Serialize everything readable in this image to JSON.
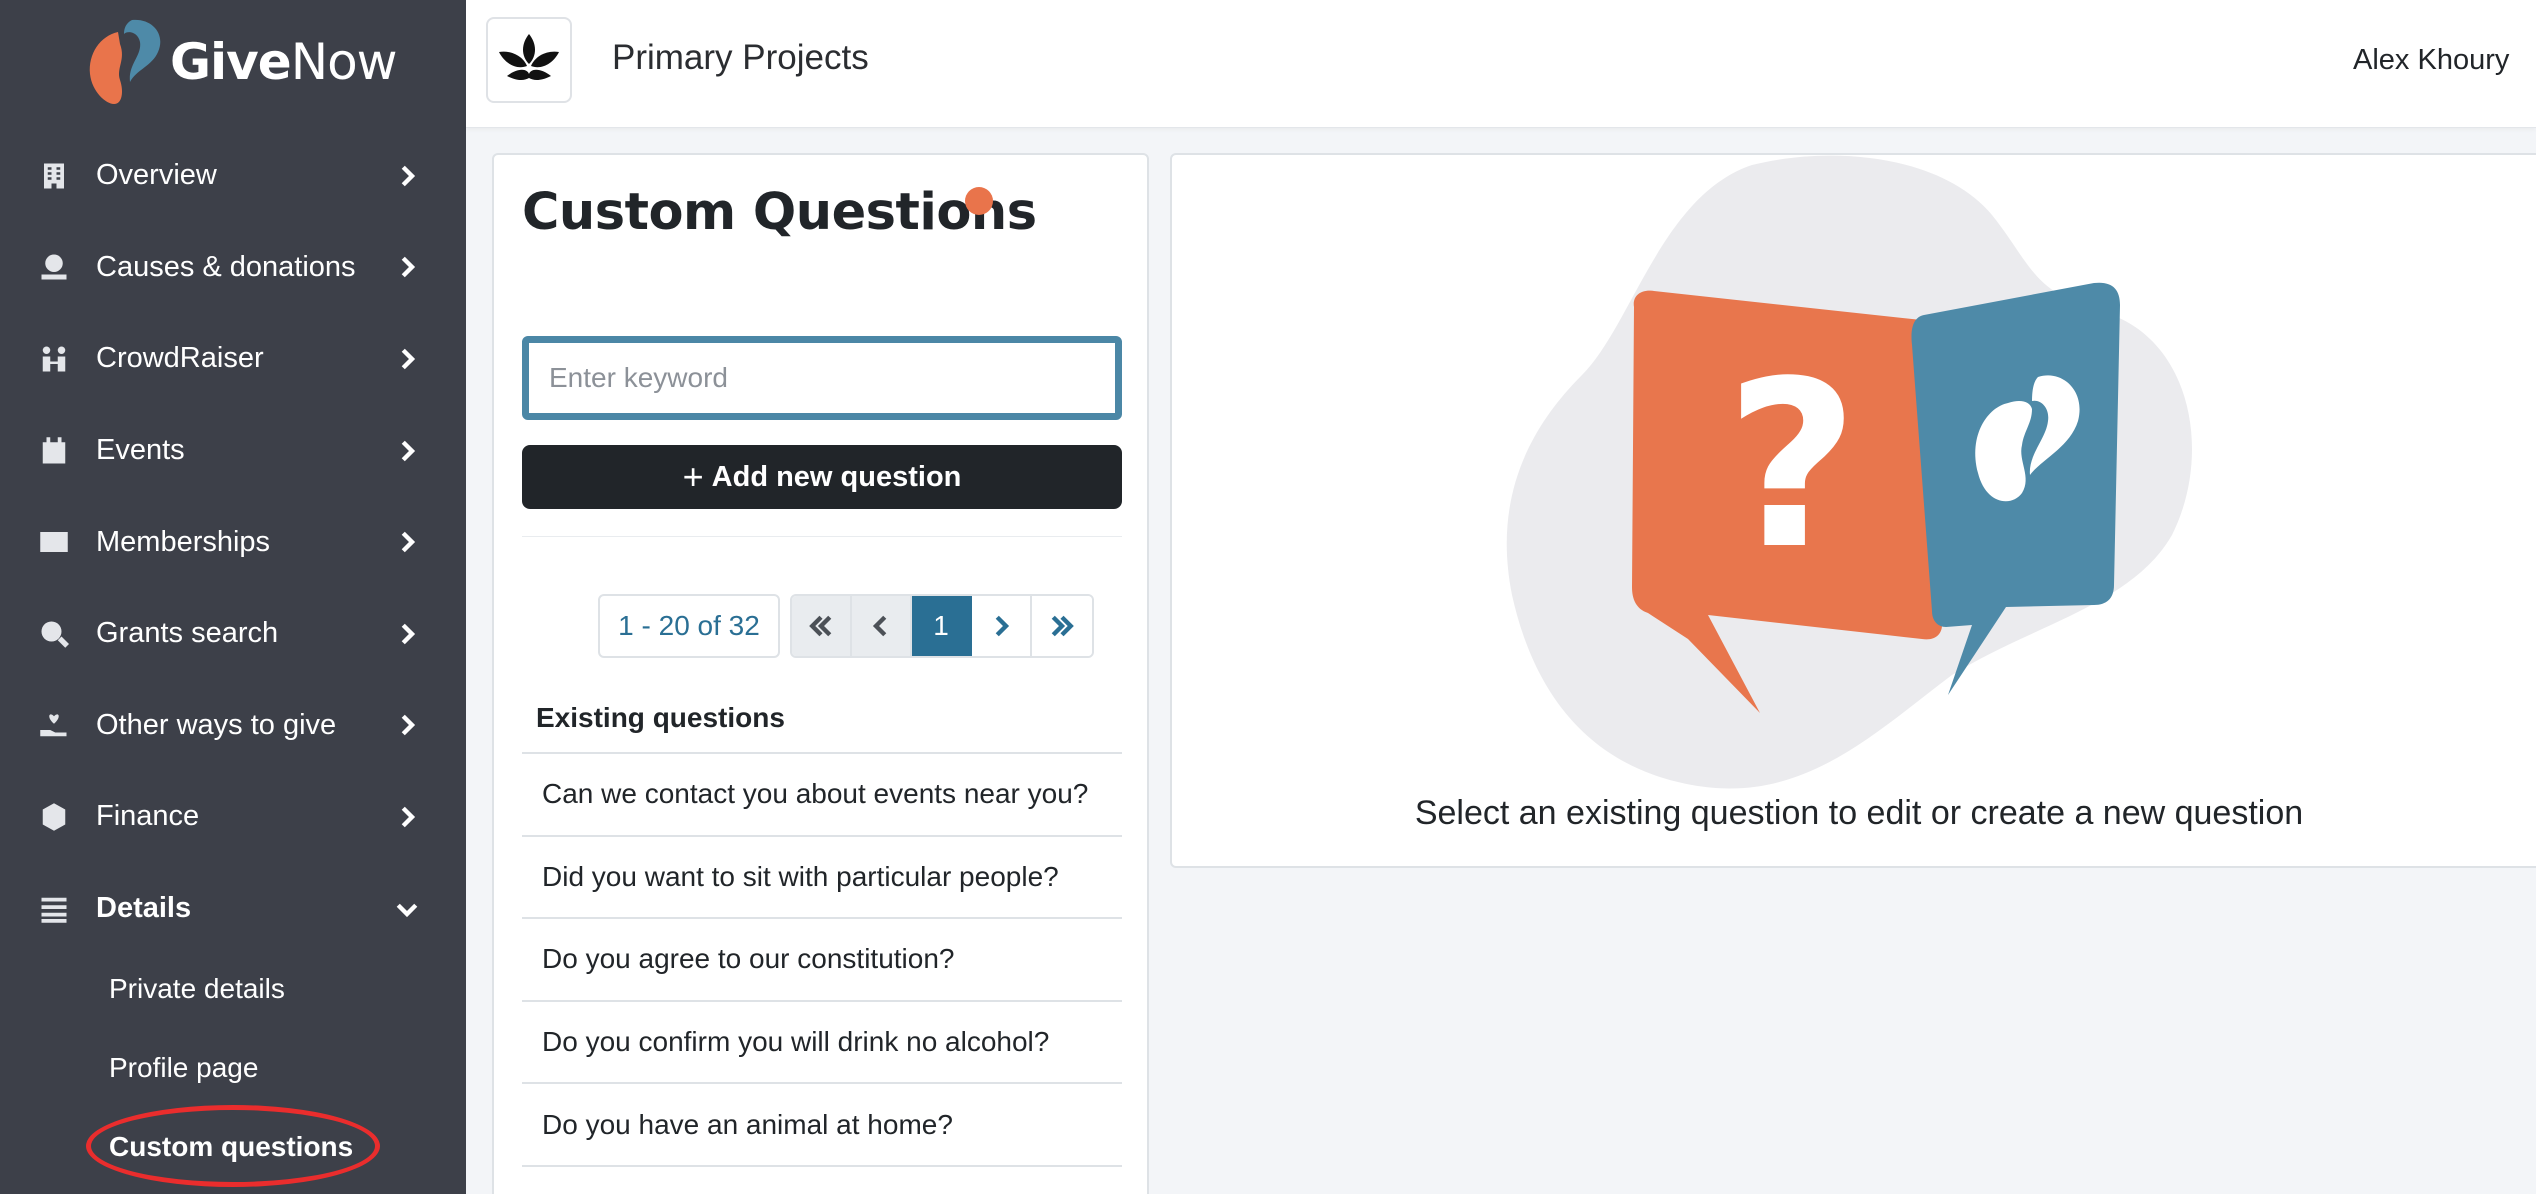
{
  "brand": {
    "name_bold": "Give",
    "name_regular": "Now"
  },
  "sidebar": {
    "items": [
      {
        "label": "Overview",
        "icon": "building-icon"
      },
      {
        "label": "Causes & donations",
        "icon": "money-hand-icon"
      },
      {
        "label": "CrowdRaiser",
        "icon": "people-icon"
      },
      {
        "label": "Events",
        "icon": "calendar-icon"
      },
      {
        "label": "Memberships",
        "icon": "id-card-icon"
      },
      {
        "label": "Grants search",
        "icon": "search-dollar-icon"
      },
      {
        "label": "Other ways to give",
        "icon": "hand-heart-icon"
      },
      {
        "label": "Finance",
        "icon": "coin-icon"
      },
      {
        "label": "Details",
        "icon": "list-icon"
      }
    ],
    "subitems": [
      {
        "label": "Private details"
      },
      {
        "label": "Profile page"
      },
      {
        "label": "Custom questions"
      }
    ]
  },
  "header": {
    "org_name": "Primary Projects",
    "user_name": "Alex Khoury"
  },
  "custom_questions": {
    "title": "Custom Questions",
    "search_placeholder": "Enter keyword",
    "search_value": "",
    "add_label": "Add new question",
    "pagination": {
      "range": "1 - 20 of 32",
      "current_page": "1"
    },
    "list_header": "Existing questions",
    "questions": [
      "Can we contact you about events near you?",
      "Did you want to sit with particular people?",
      "Do you agree to our constitution?",
      "Do you confirm you will drink no alcohol?",
      "Do you have an animal at home?"
    ]
  },
  "empty_state": {
    "message": "Select an existing question to edit or create a new question"
  },
  "colors": {
    "sidebar_bg": "#3d4049",
    "accent_blue": "#2a6f94",
    "accent_orange": "#e9744b",
    "highlight_red": "#ea2d2d"
  }
}
